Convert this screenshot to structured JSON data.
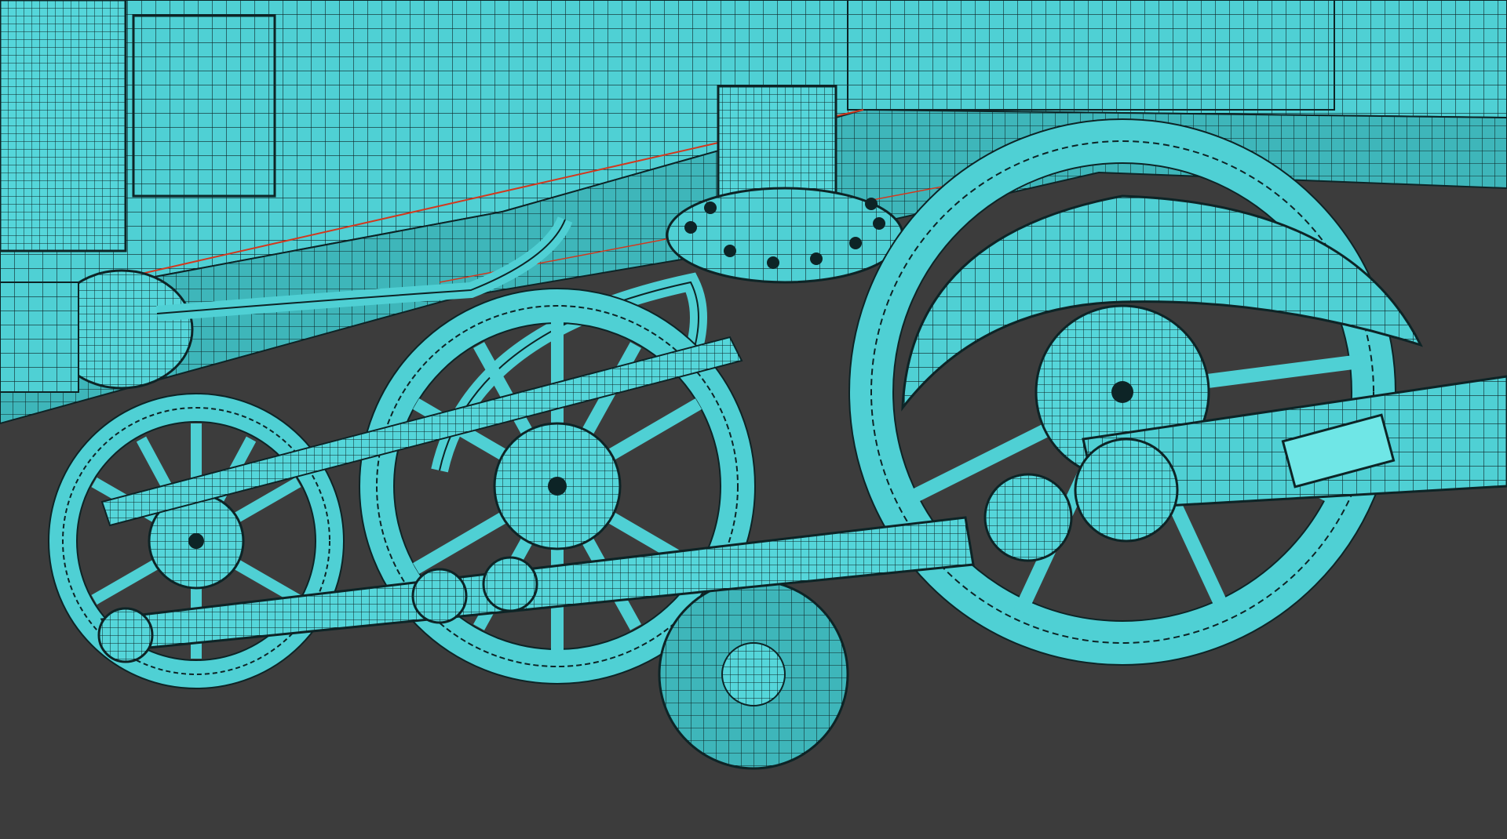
{
  "scene": {
    "subject": "steam-locomotive-wireframe",
    "colors": {
      "background": "#3c3c3c",
      "mesh_fill": "#4fd0d4",
      "mesh_fill_light": "#6fe6e6",
      "mesh_fill_dark": "#38a9ad",
      "wire": "#0d2426",
      "seam": "#d2381e"
    }
  }
}
